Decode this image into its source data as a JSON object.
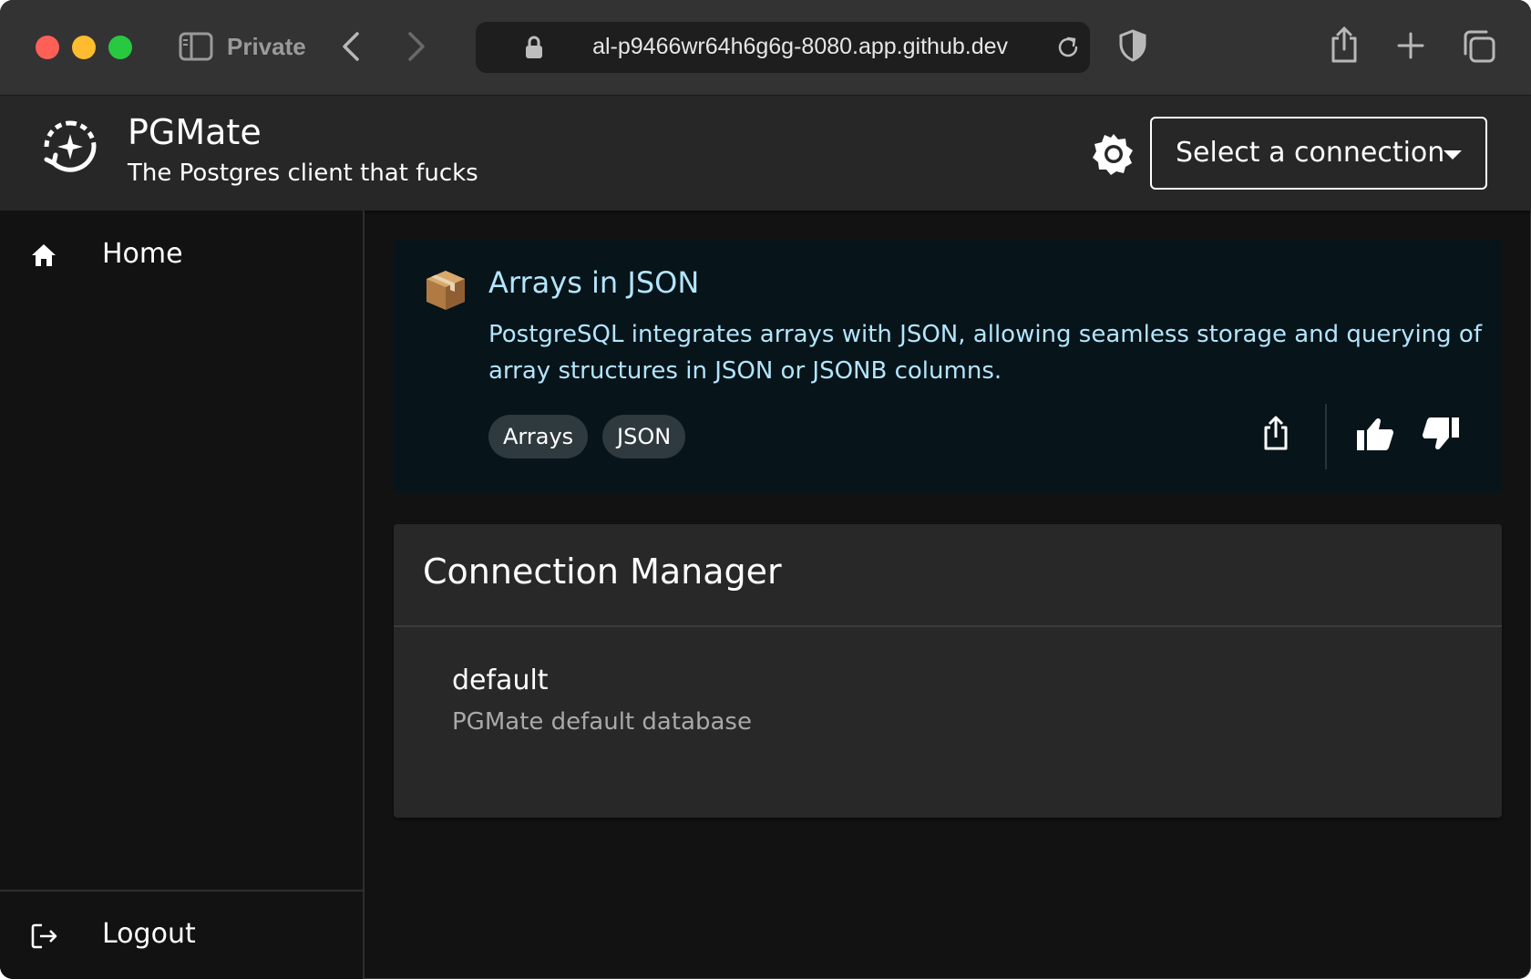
{
  "browser": {
    "mode_label": "Private",
    "url": "al-p9466wr64h6g6g-8080.app.github.dev"
  },
  "app": {
    "title": "PGMate",
    "subtitle": "The Postgres client that fucks",
    "connection_select": {
      "selected_label": "Select a connection"
    }
  },
  "sidebar": {
    "items": [
      {
        "label": "Home",
        "icon": "home-icon"
      }
    ],
    "footer_items": [
      {
        "label": "Logout",
        "icon": "logout-icon"
      }
    ]
  },
  "tip": {
    "icon": "package-emoji",
    "title": "Arrays in JSON",
    "text": "PostgreSQL integrates arrays with JSON, allowing seamless storage and querying of array structures in JSON or JSONB columns.",
    "tags": [
      "Arrays",
      "JSON"
    ]
  },
  "connection_manager": {
    "title": "Connection Manager",
    "connections": [
      {
        "name": "default",
        "description": "PGMate default database"
      }
    ]
  },
  "colors": {
    "tip_text": "#b3e5fc",
    "tip_background": "#07141a",
    "header_background": "#272727",
    "page_background": "#121212"
  }
}
